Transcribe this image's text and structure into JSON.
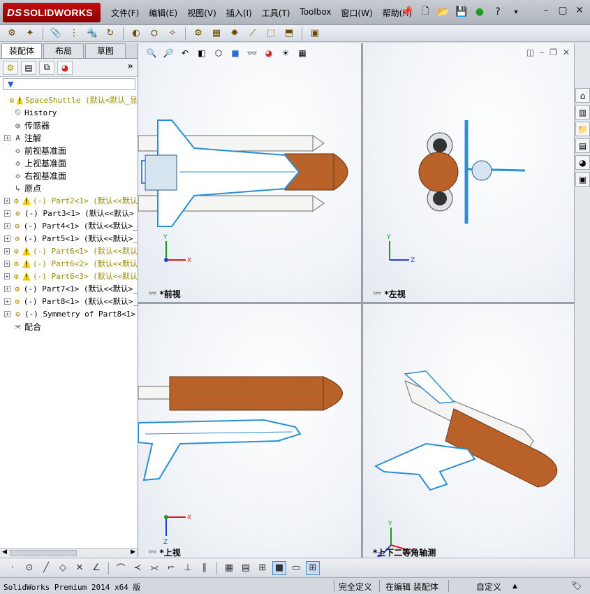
{
  "app": {
    "logo_brand": "DS",
    "logo_text": "SOLIDWORKS"
  },
  "menu": [
    "文件(F)",
    "编辑(E)",
    "视图(V)",
    "插入(I)",
    "工具(T)",
    "Toolbox",
    "窗口(W)",
    "帮助(H)"
  ],
  "left_panel": {
    "tabs": [
      "装配体",
      "布局",
      "草图"
    ],
    "more_glyph": "»"
  },
  "tree": [
    {
      "label": "SpaceShuttle  (默认<默认_显",
      "icon": "assembly-icon",
      "warn": true,
      "color": "olive",
      "expander": false
    },
    {
      "label": "History",
      "icon": "history-icon",
      "warn": false,
      "color": "black",
      "expander": false
    },
    {
      "label": "传感器",
      "icon": "sensor-icon",
      "warn": false,
      "color": "black",
      "expander": false
    },
    {
      "label": "注解",
      "icon": "annotation-icon",
      "warn": false,
      "color": "black",
      "expander": true
    },
    {
      "label": "前视基准面",
      "icon": "plane-icon",
      "warn": false,
      "color": "black",
      "expander": false
    },
    {
      "label": "上视基准面",
      "icon": "plane-icon",
      "warn": false,
      "color": "black",
      "expander": false
    },
    {
      "label": "右视基准面",
      "icon": "plane-icon",
      "warn": false,
      "color": "black",
      "expander": false
    },
    {
      "label": "原点",
      "icon": "origin-icon",
      "warn": false,
      "color": "black",
      "expander": false
    },
    {
      "label": "(-) Part2<1> (默认<<默认",
      "icon": "part-icon",
      "warn": true,
      "color": "olive",
      "expander": true
    },
    {
      "label": "(-) Part3<1> (默认<<默认>",
      "icon": "part-icon",
      "warn": false,
      "color": "black",
      "expander": true
    },
    {
      "label": "(-) Part4<1> (默认<<默认>_",
      "icon": "part-icon",
      "warn": false,
      "color": "black",
      "expander": true
    },
    {
      "label": "(-) Part5<1> (默认<<默认>_",
      "icon": "part-icon",
      "warn": false,
      "color": "black",
      "expander": true
    },
    {
      "label": "(-) Part6<1> (默认<<默认",
      "icon": "part-icon",
      "warn": true,
      "color": "olive",
      "expander": true
    },
    {
      "label": "(-) Part6<2> (默认<<默认",
      "icon": "part-icon",
      "warn": true,
      "color": "olive",
      "expander": true
    },
    {
      "label": "(-) Part6<3> (默认<<默认",
      "icon": "part-icon",
      "warn": true,
      "color": "olive",
      "expander": true
    },
    {
      "label": "(-) Part7<1> (默认<<默认>_",
      "icon": "part-icon",
      "warn": false,
      "color": "black",
      "expander": true
    },
    {
      "label": "(-) Part8<1> (默认<<默认>_",
      "icon": "part-icon",
      "warn": false,
      "color": "black",
      "expander": true
    },
    {
      "label": "(-) Symmetry of Part8<1>",
      "icon": "part-icon",
      "warn": false,
      "color": "black",
      "expander": true
    },
    {
      "label": "配合",
      "icon": "mates-icon",
      "warn": false,
      "color": "black",
      "expander": false
    }
  ],
  "views": {
    "front": "*前视",
    "left": "*左视",
    "top": "*上视",
    "iso": "*上下二等角轴测"
  },
  "axes": {
    "x": "X",
    "y": "Y",
    "z": "Z"
  },
  "status": {
    "product": "SolidWorks Premium 2014 x64 版",
    "definition": "完全定义",
    "mode": "在编辑 装配体",
    "units": "自定义",
    "units_arrow": "▲"
  },
  "colors": {
    "shuttle_outline": "#2b8fd6",
    "external_tank": "#b8622a",
    "booster_white": "#f4f4f2",
    "warning": "#f7d000",
    "axis_x": "#d62020",
    "axis_y": "#1a9a1a",
    "axis_z": "#2040d0"
  }
}
